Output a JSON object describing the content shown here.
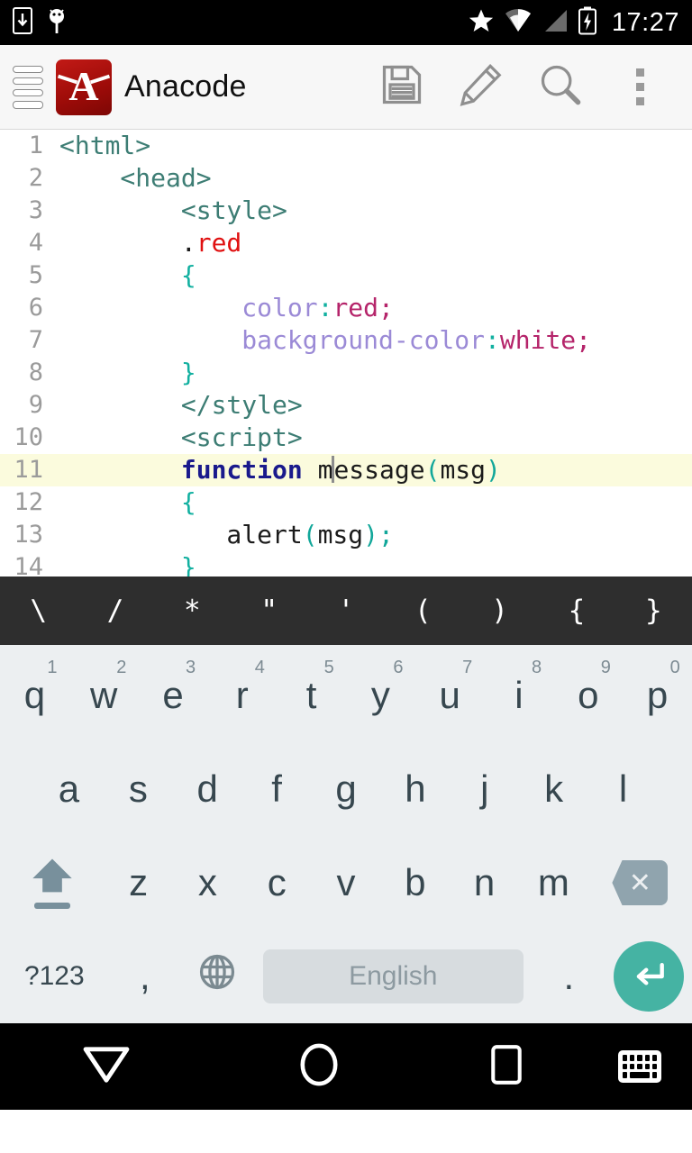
{
  "status_bar": {
    "icons_left": [
      "download-icon",
      "android-icon"
    ],
    "icons_right": [
      "star-icon",
      "wifi-icon",
      "signal-icon",
      "battery-charging-icon"
    ],
    "time": "17:27"
  },
  "app_bar": {
    "drawer_icon": "file-list-icon",
    "logo_letter": "A",
    "title": "Anacode",
    "actions": [
      {
        "name": "save-button",
        "icon": "floppy-disk-icon"
      },
      {
        "name": "edit-button",
        "icon": "pencil-icon"
      },
      {
        "name": "search-button",
        "icon": "magnifier-icon"
      },
      {
        "name": "overflow-button",
        "icon": "kebab-menu-icon"
      }
    ]
  },
  "editor": {
    "active_line": 11,
    "lines": [
      {
        "num": "1",
        "tokens": [
          {
            "t": "<html>",
            "c": "tag",
            "indent": 0
          }
        ]
      },
      {
        "num": "2",
        "tokens": [
          {
            "t": "<head>",
            "c": "tag",
            "indent": 4
          }
        ]
      },
      {
        "num": "3",
        "tokens": [
          {
            "t": "<style>",
            "c": "tag",
            "indent": 8
          }
        ]
      },
      {
        "num": "4",
        "tokens": [
          {
            "t": ".",
            "c": "plain",
            "indent": 8
          },
          {
            "t": "red",
            "c": "sel"
          }
        ]
      },
      {
        "num": "5",
        "tokens": [
          {
            "t": "{",
            "c": "brace",
            "indent": 8
          }
        ]
      },
      {
        "num": "6",
        "tokens": [
          {
            "t": "color",
            "c": "prop",
            "indent": 12
          },
          {
            "t": ":",
            "c": "colon"
          },
          {
            "t": "red;",
            "c": "val"
          }
        ]
      },
      {
        "num": "7",
        "tokens": [
          {
            "t": "background-color",
            "c": "prop",
            "indent": 12
          },
          {
            "t": ":",
            "c": "colon"
          },
          {
            "t": "white;",
            "c": "val"
          }
        ]
      },
      {
        "num": "8",
        "tokens": [
          {
            "t": "}",
            "c": "brace",
            "indent": 8
          }
        ]
      },
      {
        "num": "9",
        "tokens": [
          {
            "t": "</style>",
            "c": "tag",
            "indent": 8
          }
        ]
      },
      {
        "num": "10",
        "tokens": [
          {
            "t": "<script>",
            "c": "tag",
            "indent": 8
          }
        ]
      },
      {
        "num": "11",
        "tokens": [
          {
            "t": "function ",
            "c": "kw",
            "indent": 8
          },
          {
            "t": "m",
            "c": "fn"
          },
          {
            "t": "",
            "c": "caret"
          },
          {
            "t": "essage",
            "c": "fn"
          },
          {
            "t": "(",
            "c": "paren"
          },
          {
            "t": "msg",
            "c": "fn"
          },
          {
            "t": ")",
            "c": "paren"
          }
        ]
      },
      {
        "num": "12",
        "tokens": [
          {
            "t": "{",
            "c": "brace",
            "indent": 8
          }
        ]
      },
      {
        "num": "13",
        "tokens": [
          {
            "t": "alert",
            "c": "plain",
            "indent": 11
          },
          {
            "t": "(",
            "c": "paren"
          },
          {
            "t": "msg",
            "c": "plain"
          },
          {
            "t": ")",
            "c": "paren"
          },
          {
            "t": ";",
            "c": "paren"
          }
        ]
      },
      {
        "num": "14",
        "tokens": [
          {
            "t": "}",
            "c": "brace",
            "indent": 8
          }
        ]
      }
    ]
  },
  "symbol_bar": {
    "symbols": [
      "\\",
      "/",
      "*",
      "\"",
      "'",
      "(",
      ")",
      "{",
      "}"
    ]
  },
  "keyboard": {
    "row1": [
      {
        "key": "q",
        "hint": "1"
      },
      {
        "key": "w",
        "hint": "2"
      },
      {
        "key": "e",
        "hint": "3"
      },
      {
        "key": "r",
        "hint": "4"
      },
      {
        "key": "t",
        "hint": "5"
      },
      {
        "key": "y",
        "hint": "6"
      },
      {
        "key": "u",
        "hint": "7"
      },
      {
        "key": "i",
        "hint": "8"
      },
      {
        "key": "o",
        "hint": "9"
      },
      {
        "key": "p",
        "hint": "0"
      }
    ],
    "row2": [
      "a",
      "s",
      "d",
      "f",
      "g",
      "h",
      "j",
      "k",
      "l"
    ],
    "row3": [
      "z",
      "x",
      "c",
      "v",
      "b",
      "n",
      "m"
    ],
    "shift_key": "shift-icon",
    "backspace_key": "backspace-icon",
    "symbols_key": "?123",
    "comma_key": ",",
    "language_key": "globe-icon",
    "spacebar_label": "English",
    "period_key": ".",
    "enter_key": "enter-icon",
    "enter_color": "#45b3a3"
  },
  "nav_bar": {
    "back": "back-triangle-icon",
    "home": "home-circle-icon",
    "recents": "recents-square-icon",
    "hide_keyboard": "keyboard-icon"
  }
}
